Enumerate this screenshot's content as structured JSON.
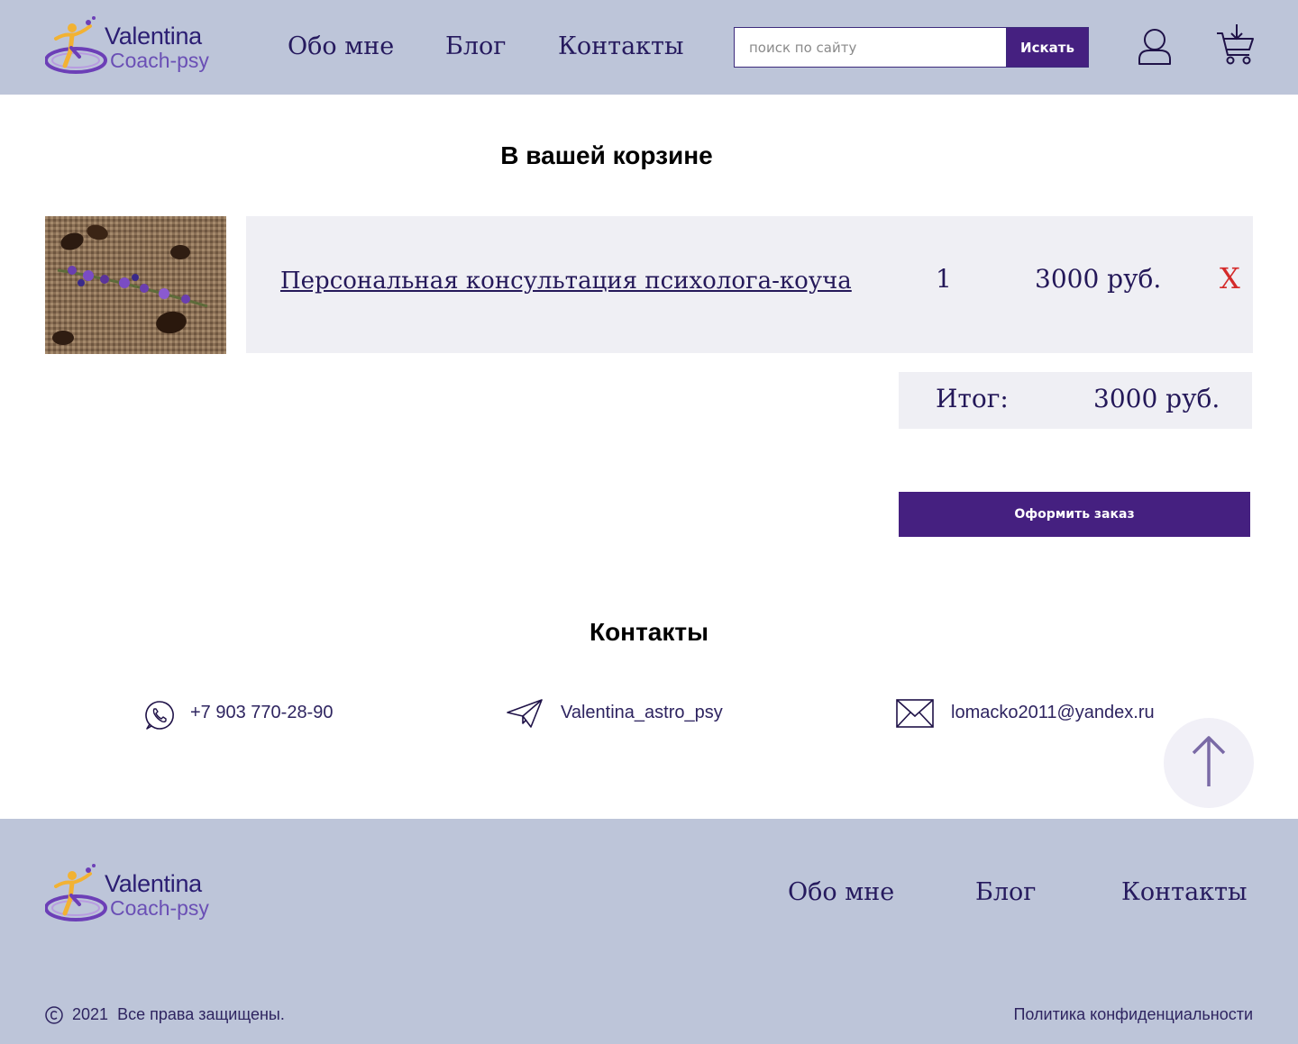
{
  "header": {
    "logo": {
      "line1": "Valentina",
      "line2": "Coach-psy"
    },
    "nav": [
      "Обо мне",
      "Блог",
      "Контакты"
    ],
    "search": {
      "placeholder": "поиск по сайту",
      "button_label": "Искать"
    },
    "icons": {
      "account": "user-icon",
      "cart": "cart-icon"
    }
  },
  "cart": {
    "title": "В вашей корзине",
    "item": {
      "name": "Персональная консультация психолога-коуча",
      "quantity": "1",
      "price": "3000 руб.",
      "remove_label": "X",
      "image": "coffee-beans-lavender-photo"
    },
    "total": {
      "label": "Итог:",
      "value": "3000 руб."
    },
    "checkout_label": "Оформить заказ"
  },
  "contacts": {
    "title": "Контакты",
    "phone": "+7 903 770-28-90",
    "telegram": "Valentina_astro_psy",
    "email": "lomacko2011@yandex.ru",
    "icons": {
      "phone": "whatsapp-icon",
      "telegram": "paper-plane-icon",
      "email": "envelope-icon"
    }
  },
  "scroll_top": {
    "icon": "arrow-up-icon"
  },
  "footer": {
    "logo": {
      "line1": "Valentina",
      "line2": "Coach-psy"
    },
    "nav": [
      "Обо мне",
      "Блог",
      "Контакты"
    ],
    "year": "2021",
    "rights": "Все права защищены.",
    "privacy": "Политика конфиденциальности"
  },
  "colors": {
    "header_bg": "#bdc5d9",
    "accent": "#452080",
    "row_bg": "#efeff4",
    "remove_red": "#d42a2a"
  }
}
